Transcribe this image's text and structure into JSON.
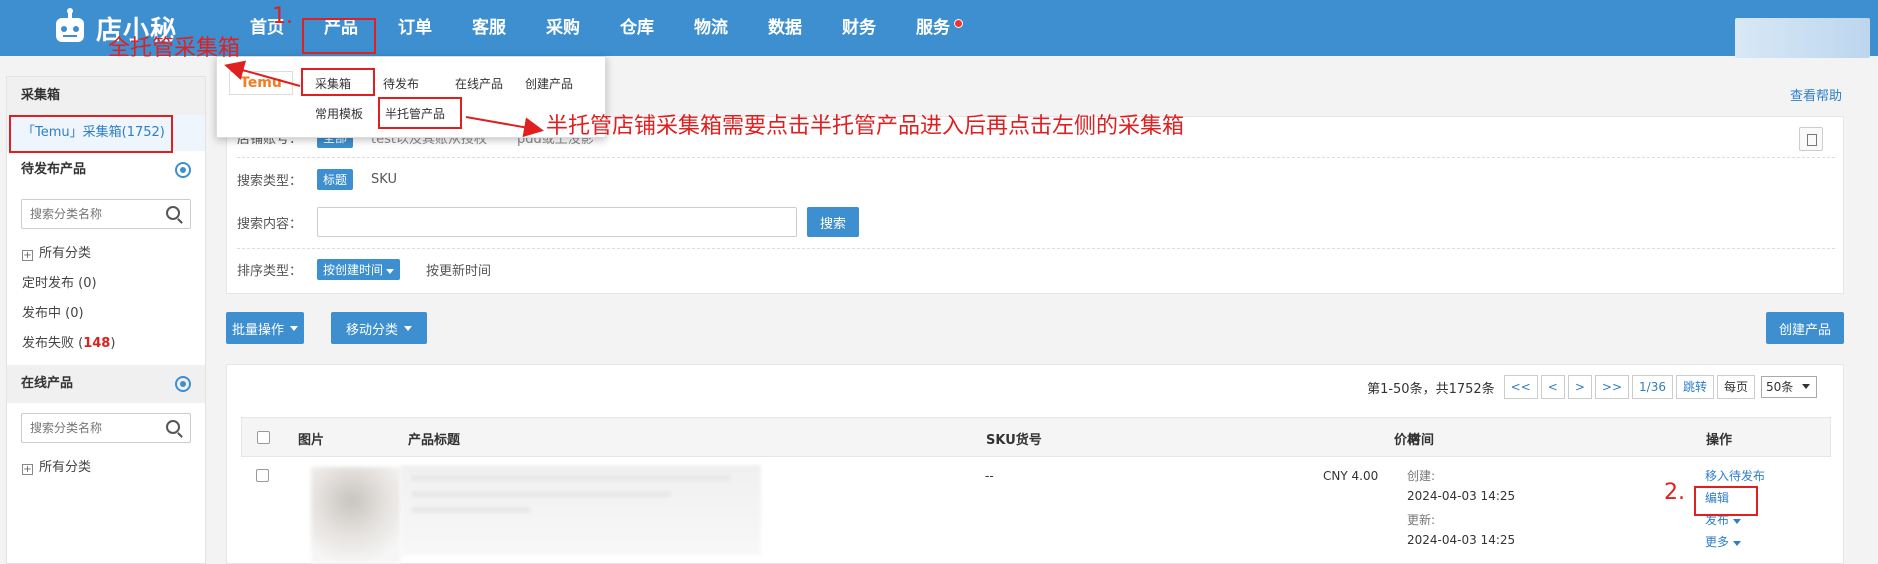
{
  "brand": {
    "logo_text": "店小秘"
  },
  "nav": {
    "items": [
      "首页",
      "产品",
      "订单",
      "客服",
      "采购",
      "仓库",
      "物流",
      "数据",
      "财务",
      "服务"
    ],
    "badge_color": "#e33333"
  },
  "dropdown": {
    "platform_logo": "Temu",
    "items": [
      "采集箱",
      "待发布",
      "在线产品",
      "创建产品",
      "常用模板",
      "半托管产品"
    ]
  },
  "sidebar": {
    "collect_title": "采集箱",
    "collect_item": "「Temu」采集箱(1752)",
    "pending_title": "待发布产品",
    "search_placeholder": "搜索分类名称",
    "all_categories": "所有分类",
    "scheduled": "定时发布 (0)",
    "publishing": "发布中 (0)",
    "failed_label": "发布失败 (",
    "failed_count": "148",
    "failed_close": ")",
    "online_title": "在线产品",
    "search_placeholder_2": "搜索分类名称",
    "all_categories_2": "所有分类"
  },
  "help_link": "查看帮助",
  "filters": {
    "store_label": "店铺账号：",
    "store_tag": "全部",
    "store_value_1": "test以及其账从授权",
    "store_value_2": "pdd或上没影",
    "search_type_label": "搜索类型：",
    "search_type_active": "标题",
    "search_type_other": "SKU",
    "search_content_label": "搜索内容：",
    "search_input_value": "",
    "search_button": "搜索",
    "sort_label": "排序类型：",
    "sort_active": "按创建时间",
    "sort_other": "按更新时间"
  },
  "toolbar": {
    "batch": "批量操作",
    "move": "移动分类",
    "create": "创建产品"
  },
  "pager": {
    "summary": "第1-50条，共1752条",
    "first": "<<",
    "prev": "<",
    "next": ">",
    "last": ">>",
    "page": "1/36",
    "jump": "跳转",
    "per_page_label": "每页",
    "per_page_value": "50条"
  },
  "table": {
    "headers": [
      "图片",
      "产品标题",
      "SKU货号",
      "价格",
      "时间",
      "操作"
    ],
    "row": {
      "sku": "--",
      "price": "CNY 4.00",
      "created_label": "创建:",
      "created": "2024-04-03 14:25",
      "updated_label": "更新:",
      "updated": "2024-04-03 14:25",
      "actions": [
        "移入待发布",
        "编辑",
        "发布",
        "更多"
      ]
    }
  },
  "annotations": {
    "step1": "1.",
    "step1_text": "全托管采集箱",
    "step2": "2.",
    "half_text": "半托管店铺采集箱需要点击半托管产品进入后再点击左侧的采集箱",
    "color": "#e02020"
  }
}
